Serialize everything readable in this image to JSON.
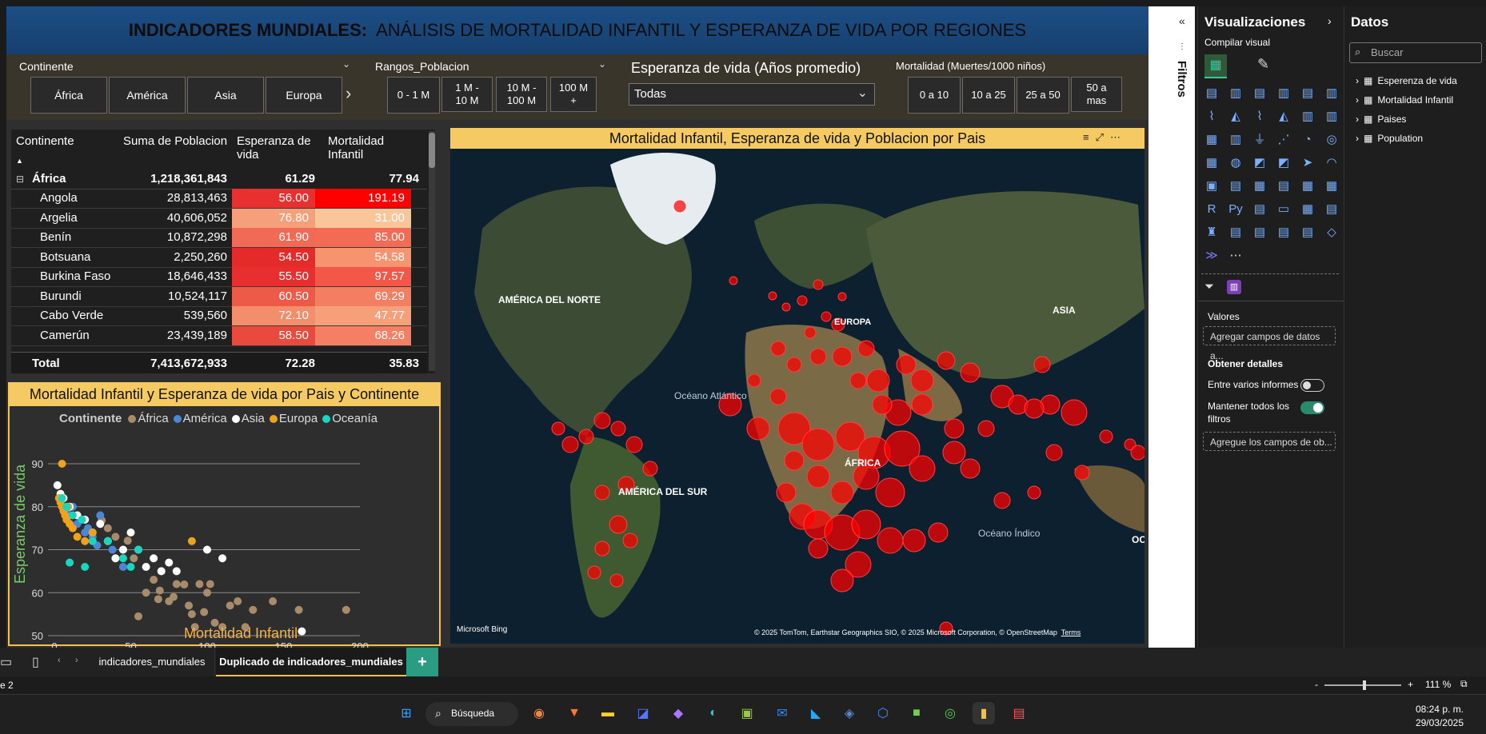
{
  "title": {
    "bold": "INDICADORES MUNDIALES:",
    "rest": "ANÁLISIS DE MORTALIDAD INFANTIL Y ESPERANZA DE VIDA POR REGIONES"
  },
  "slicers": {
    "continente": {
      "title": "Continente",
      "options": [
        "África",
        "América",
        "Asia",
        "Europa"
      ]
    },
    "rangos": {
      "title": "Rangos_Poblacion",
      "options": [
        "0 - 1 M",
        "1 M - 10 M",
        "10 M - 100 M",
        "100 M +"
      ]
    },
    "esperanza": {
      "title": "Esperanza de vida (Años promedio)",
      "selected": "Todas"
    },
    "mortalidad": {
      "title": "Mortalidad (Muertes/1000 niños)",
      "options": [
        "0 a 10",
        "10 a 25",
        "25 a 50",
        "50 a mas"
      ]
    }
  },
  "table": {
    "headers": [
      "Continente",
      "Suma de Poblacion",
      "Esperanza de vida",
      "Mortalidad Infantil"
    ],
    "group": {
      "name": "África",
      "pop": "1,218,361,843",
      "life": "61.29",
      "mort": "77.94"
    },
    "rows": [
      {
        "name": "Angola",
        "pop": "28,813,463",
        "life": "56.00",
        "mort": "191.19",
        "lc": "#e83030",
        "mc": "#ff0000"
      },
      {
        "name": "Argelia",
        "pop": "40,606,052",
        "life": "76.80",
        "mort": "31.00",
        "lc": "#f5a07a",
        "mc": "#fbc59a"
      },
      {
        "name": "Benín",
        "pop": "10,872,298",
        "life": "61.90",
        "mort": "85.00",
        "lc": "#f06a55",
        "mc": "#f36a55"
      },
      {
        "name": "Botsuana",
        "pop": "2,250,260",
        "life": "54.50",
        "mort": "54.58",
        "lc": "#e52a2a",
        "mc": "#f5946e"
      },
      {
        "name": "Burkina Faso",
        "pop": "18,646,433",
        "life": "55.50",
        "mort": "97.57",
        "lc": "#e82e2e",
        "mc": "#f25747"
      },
      {
        "name": "Burundi",
        "pop": "10,524,117",
        "life": "60.50",
        "mort": "69.29",
        "lc": "#ed5a48",
        "mc": "#f47e62"
      },
      {
        "name": "Cabo Verde",
        "pop": "539,560",
        "life": "72.10",
        "mort": "47.77",
        "lc": "#f38e6c",
        "mc": "#f6a07a"
      },
      {
        "name": "Camerún",
        "pop": "23,439,189",
        "life": "58.50",
        "mort": "68.26",
        "lc": "#ea4a3e",
        "mc": "#f47f63"
      }
    ],
    "total": {
      "name": "Total",
      "pop": "7,413,672,933",
      "life": "72.28",
      "mort": "35.83"
    }
  },
  "scatter": {
    "title": "Mortalidad Infantil y Esperanza de vida por Pais y Continente",
    "legend_label": "Continente",
    "legend": [
      {
        "name": "África",
        "color": "#a78b6a"
      },
      {
        "name": "América",
        "color": "#4a86d6"
      },
      {
        "name": "Asia",
        "color": "#ffffff"
      },
      {
        "name": "Europa",
        "color": "#f0a21a"
      },
      {
        "name": "Oceanía",
        "color": "#19d6c0"
      }
    ],
    "xlabel": "Mortalidad Infantil",
    "ylabel": "Esperanza de vida"
  },
  "chart_data": {
    "type": "scatter",
    "title": "Mortalidad Infantil y Esperanza de vida por Pais y Continente",
    "xlabel": "Mortalidad Infantil",
    "ylabel": "Esperanza de vida",
    "xlim": [
      0,
      200
    ],
    "ylim": [
      50,
      90
    ],
    "x_ticks": [
      "0",
      "50",
      "100",
      "150",
      "200"
    ],
    "y_ticks": [
      "50",
      "60",
      "70",
      "80",
      "90"
    ],
    "series": [
      {
        "name": "África",
        "points": [
          [
            191,
            56
          ],
          [
            31,
            76.8
          ],
          [
            85,
            61.9
          ],
          [
            55,
            54.5
          ],
          [
            98,
            55.5
          ],
          [
            69,
            60.5
          ],
          [
            48,
            72.1
          ],
          [
            68,
            58.5
          ],
          [
            60,
            60
          ],
          [
            75,
            58
          ],
          [
            90,
            55
          ],
          [
            110,
            52
          ],
          [
            120,
            58
          ],
          [
            130,
            56
          ],
          [
            143,
            58
          ],
          [
            160,
            56
          ],
          [
            80,
            62
          ],
          [
            95,
            62
          ],
          [
            100,
            60
          ],
          [
            105,
            53
          ],
          [
            115,
            57
          ],
          [
            125,
            52
          ],
          [
            70,
            65
          ],
          [
            40,
            73
          ],
          [
            45,
            70
          ],
          [
            52,
            68
          ],
          [
            35,
            75
          ],
          [
            88,
            57
          ],
          [
            65,
            63
          ],
          [
            78,
            59
          ],
          [
            92,
            52
          ],
          [
            102,
            62
          ]
        ]
      },
      {
        "name": "América",
        "points": [
          [
            5,
            82
          ],
          [
            10,
            78
          ],
          [
            15,
            76
          ],
          [
            20,
            74
          ],
          [
            25,
            73
          ],
          [
            30,
            78
          ],
          [
            35,
            72
          ],
          [
            12,
            80
          ],
          [
            18,
            77
          ],
          [
            22,
            75
          ],
          [
            28,
            71
          ],
          [
            38,
            70
          ],
          [
            8,
            79
          ],
          [
            45,
            66
          ]
        ]
      },
      {
        "name": "Asia",
        "points": [
          [
            2,
            85
          ],
          [
            4,
            83
          ],
          [
            6,
            82
          ],
          [
            10,
            80
          ],
          [
            15,
            78
          ],
          [
            20,
            77
          ],
          [
            25,
            74
          ],
          [
            30,
            76
          ],
          [
            35,
            72
          ],
          [
            40,
            68
          ],
          [
            50,
            74
          ],
          [
            55,
            70
          ],
          [
            60,
            66
          ],
          [
            65,
            68
          ],
          [
            75,
            67
          ],
          [
            80,
            65
          ],
          [
            100,
            70
          ],
          [
            110,
            68
          ],
          [
            162,
            51
          ],
          [
            45,
            70
          ],
          [
            70,
            65
          ]
        ]
      },
      {
        "name": "Europa",
        "points": [
          [
            3,
            82
          ],
          [
            4,
            81
          ],
          [
            5,
            80
          ],
          [
            6,
            79
          ],
          [
            7,
            78
          ],
          [
            8,
            77
          ],
          [
            10,
            76
          ],
          [
            12,
            75
          ],
          [
            15,
            73
          ],
          [
            20,
            72
          ],
          [
            25,
            74
          ],
          [
            5,
            90
          ],
          [
            90,
            72
          ],
          [
            9,
            80
          ]
        ]
      },
      {
        "name": "Oceanía",
        "points": [
          [
            5,
            82
          ],
          [
            8,
            80
          ],
          [
            12,
            78
          ],
          [
            18,
            77
          ],
          [
            25,
            72
          ],
          [
            35,
            72
          ],
          [
            45,
            68
          ],
          [
            55,
            70
          ],
          [
            10,
            67
          ],
          [
            20,
            66
          ],
          [
            50,
            66
          ]
        ]
      }
    ]
  },
  "map": {
    "title": "Mortalidad Infantil, Esperanza de vida y Poblacion por Pais",
    "labels": {
      "na": "AMÉRICA DEL NORTE",
      "sa": "AMÉRICA DEL SUR",
      "eu": "EUROPA",
      "af": "ÁFRICA",
      "as": "ASIA",
      "atl": "Océano Atlántico",
      "ind": "Océano Índico",
      "oc": "OC"
    },
    "attribution": "© 2025 TomTom, Earthstar Geographics SIO, © 2025 Microsoft Corporation, © OpenStreetMap",
    "terms": "Terms",
    "bing": "Microsoft Bing"
  },
  "filters_label": "Filtros",
  "viz_panel": {
    "title": "Visualizaciones",
    "build": "Compilar visual",
    "values": "Valores",
    "values_placeholder": "Agregar campos de datos a...",
    "details": "Obtener detalles",
    "cross_report": "Entre varios informes",
    "keep_filters": "Mantener todos los filtros",
    "drill_placeholder": "Agregue los campos de ob..."
  },
  "data_panel": {
    "title": "Datos",
    "search_placeholder": "Buscar",
    "tables": [
      "Esperenza de vida",
      "Mortalidad Infantil",
      "Paises",
      "Population"
    ]
  },
  "tabs": [
    "indicadores_mundiales",
    "Duplicado de indicadores_mundiales"
  ],
  "status": {
    "page": "e 2",
    "zoom": "111 %"
  },
  "taskbar": {
    "search": "Búsqueda",
    "time": "08:24 p. m.",
    "date": "29/03/2025"
  },
  "colors": {
    "accent": "#f6ca62",
    "banner": "#1c4f86",
    "red": "#ff0000"
  }
}
